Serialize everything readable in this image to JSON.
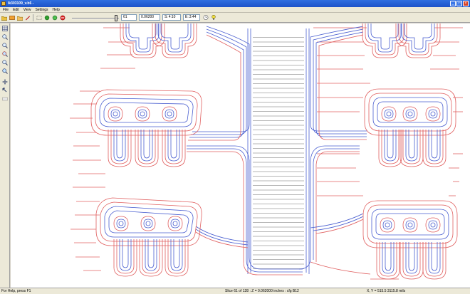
{
  "window": {
    "title": "lk303109_v.b6 -",
    "min_label": "_",
    "max_label": "□",
    "close_label": "×"
  },
  "menu": [
    {
      "label": "File"
    },
    {
      "label": "Edit"
    },
    {
      "label": "View"
    },
    {
      "label": "Settings"
    },
    {
      "label": "Help"
    }
  ],
  "toolbar": {
    "slice_number": "61",
    "z_value": "0.06200",
    "s_label": "S:",
    "s_value": "4:10",
    "e_label": "E:",
    "e_value": "3:44"
  },
  "status": {
    "help_text": "For Help, press F1",
    "slice_text": "Slice   61 of   128 : Z = 0.062000 inches : cfg B12",
    "coords_text": "X, Y =     515.5    3115.8 mils"
  },
  "colors": {
    "outline_red": "#e06060",
    "outline_blue": "#4a5fd0",
    "hatch_gray": "#707070",
    "title_blue": "#245edb"
  }
}
